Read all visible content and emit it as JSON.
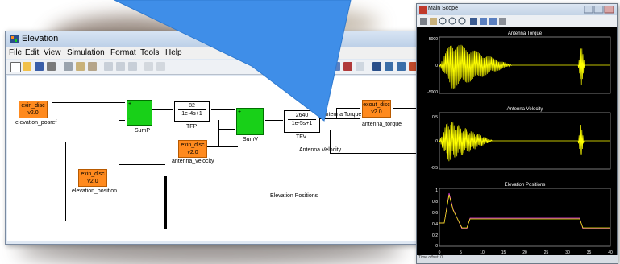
{
  "sim_window": {
    "title": "Elevation",
    "menu": [
      "File",
      "Edit",
      "View",
      "Simulation",
      "Format",
      "Tools",
      "Help"
    ]
  },
  "blocks": {
    "exin_label": "exin_disc",
    "exin_version": "v2.0",
    "exout_label": "exout_disc",
    "elevation_posref": "elevation_posref",
    "elevation_position": "elevation_position",
    "antenna_velocity": "antenna_velocity",
    "antenna_torque": "antenna_torque",
    "sump": "SumP",
    "sumv": "SumV",
    "tfp_num": "82",
    "tfp_den": "1e-4s+1",
    "tfp": "TFP",
    "tfv_num": "2640",
    "tfv_den": "1e-5s+1",
    "tfv": "TFV",
    "plus": "+",
    "minus": "-"
  },
  "signals": {
    "antenna_torque": "Antenna Torque",
    "antenna_velocity": "Antenna Velocity",
    "elevation_positions": "Elevation Positions"
  },
  "scope": {
    "title": "Main Scope",
    "plot1": {
      "title": "Antenna Torque",
      "ticks": [
        "5000",
        "0",
        "-5000"
      ]
    },
    "plot2": {
      "title": "Antenna Velocity",
      "ticks": [
        "0.5",
        "0",
        "-0.5"
      ]
    },
    "plot3": {
      "title": "Elevation Positions",
      "ticks": [
        "1",
        "0.8",
        "0.6",
        "0.4",
        "0.2",
        "0"
      ]
    },
    "xticks": [
      "0",
      "5",
      "10",
      "15",
      "20",
      "25",
      "30",
      "35",
      "40"
    ],
    "footer": "Time offset:  0",
    "trace_color": "#ffff00",
    "pos_color": "#ff3fff"
  }
}
